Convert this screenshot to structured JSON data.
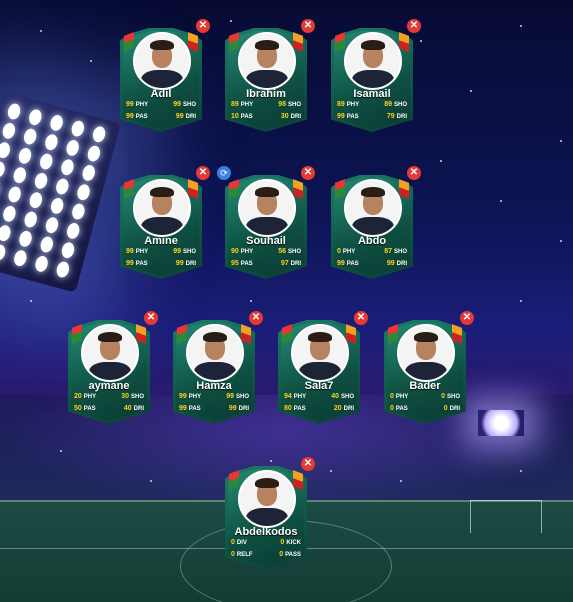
{
  "colors": {
    "close": "#e53935",
    "swap": "#3c7fe0",
    "stat_value": "#ffd21f"
  },
  "icons": {
    "close": "close-icon",
    "swap": "swap-icon"
  },
  "cards": [
    {
      "name": "Adil",
      "stats": [
        {
          "value": "99",
          "label": "PHY"
        },
        {
          "value": "99",
          "label": "SHO"
        },
        {
          "value": "99",
          "label": "PAS"
        },
        {
          "value": "99",
          "label": "DRI"
        }
      ]
    },
    {
      "name": "Ibrahim",
      "stats": [
        {
          "value": "89",
          "label": "PHY"
        },
        {
          "value": "98",
          "label": "SHO"
        },
        {
          "value": "10",
          "label": "PAS"
        },
        {
          "value": "30",
          "label": "DRI"
        }
      ]
    },
    {
      "name": "Isamail",
      "stats": [
        {
          "value": "89",
          "label": "PHY"
        },
        {
          "value": "89",
          "label": "SHO"
        },
        {
          "value": "99",
          "label": "PAS"
        },
        {
          "value": "79",
          "label": "DRI"
        }
      ]
    },
    {
      "name": "Amine",
      "stats": [
        {
          "value": "99",
          "label": "PHY"
        },
        {
          "value": "99",
          "label": "SHO"
        },
        {
          "value": "99",
          "label": "PAS"
        },
        {
          "value": "99",
          "label": "DRI"
        }
      ]
    },
    {
      "name": "Souhail",
      "stats": [
        {
          "value": "90",
          "label": "PHY"
        },
        {
          "value": "56",
          "label": "SHO"
        },
        {
          "value": "95",
          "label": "PAS"
        },
        {
          "value": "97",
          "label": "DRI"
        }
      ]
    },
    {
      "name": "Abdo",
      "stats": [
        {
          "value": "0",
          "label": "PHY"
        },
        {
          "value": "87",
          "label": "SHO"
        },
        {
          "value": "99",
          "label": "PAS"
        },
        {
          "value": "99",
          "label": "DRI"
        }
      ]
    },
    {
      "name": "aymane",
      "stats": [
        {
          "value": "20",
          "label": "PHY"
        },
        {
          "value": "30",
          "label": "SHO"
        },
        {
          "value": "50",
          "label": "PAS"
        },
        {
          "value": "40",
          "label": "DRI"
        }
      ]
    },
    {
      "name": "Hamza",
      "stats": [
        {
          "value": "99",
          "label": "PHY"
        },
        {
          "value": "99",
          "label": "SHO"
        },
        {
          "value": "99",
          "label": "PAS"
        },
        {
          "value": "99",
          "label": "DRI"
        }
      ]
    },
    {
      "name": "Sala7",
      "stats": [
        {
          "value": "94",
          "label": "PHY"
        },
        {
          "value": "40",
          "label": "SHO"
        },
        {
          "value": "80",
          "label": "PAS"
        },
        {
          "value": "20",
          "label": "DRI"
        }
      ]
    },
    {
      "name": "Bader",
      "stats": [
        {
          "value": "0",
          "label": "PHY"
        },
        {
          "value": "0",
          "label": "SHO"
        },
        {
          "value": "0",
          "label": "PAS"
        },
        {
          "value": "0",
          "label": "DRI"
        }
      ]
    },
    {
      "name": "Abdelkodos",
      "stats": [
        {
          "value": "0",
          "label": "DIV"
        },
        {
          "value": "0",
          "label": "KICK"
        },
        {
          "value": "0",
          "label": "RELF"
        },
        {
          "value": "0",
          "label": "PASS"
        }
      ]
    }
  ]
}
